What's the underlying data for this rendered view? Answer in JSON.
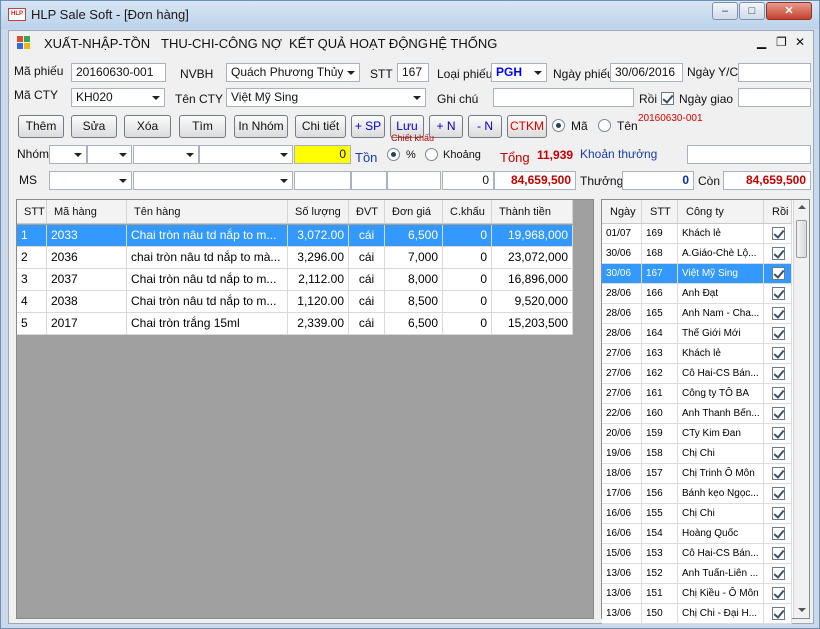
{
  "window": {
    "title": "HLP Sale Soft - [Đơn hàng]",
    "icon_text": "HLP"
  },
  "menu": {
    "items": [
      "XUẤT-NHẬP-TỒN",
      "THU-CHI-CÔNG NỢ",
      "KẾT QUẢ HOẠT ĐỘNG",
      "HỆ THỐNG"
    ]
  },
  "form": {
    "ma_phieu_label": "Mã phiếu",
    "ma_phieu": "20160630-001",
    "nvbh_label": "NVBH",
    "nvbh": "Quách Phương Thủy",
    "stt_label": "STT",
    "stt": "167",
    "loai_phieu_label": "Loại phiếu",
    "loai_phieu": "PGH",
    "ngay_phieu_label": "Ngày phiếu",
    "ngay_phieu": "30/06/2016",
    "ngay_yc_label": "Ngày Y/C",
    "ngay_yc": "",
    "ma_cty_label": "Mã CTY",
    "ma_cty": "KH020",
    "ten_cty_label": "Tên CTY",
    "ten_cty": "Việt Mỹ Sing",
    "ghi_chu_label": "Ghi chú",
    "ghi_chu": "",
    "roi_label": "Rồi",
    "ngay_giao_label": "Ngày giao",
    "ngay_giao": ""
  },
  "toolbar": {
    "them": "Thêm",
    "sua": "Sửa",
    "xoa": "Xóa",
    "tim": "Tìm",
    "in_nhom": "In Nhóm",
    "chi_tiet": "Chi tiết",
    "add_sp": "+ SP",
    "luu": "Lưu",
    "add_n": "+ N",
    "sub_n": "- N",
    "ctkm": "CTKM",
    "ma_radio": "Mã",
    "ten_radio": "Tên",
    "code_ref": "20160630-001"
  },
  "discount": {
    "nhom_label": "Nhóm",
    "ton_value": "0",
    "ton_label": "Tồn",
    "chiet_khau_label": "Chiết khấu",
    "percent_label": "%",
    "khoang_label": "Khoảng",
    "tong_label": "Tổng",
    "tong_value": "11,939",
    "khoan_thuong_label": "Khoản thưởng",
    "khoan_thuong": ""
  },
  "summary": {
    "ms_label": "MS",
    "qty_value": "0",
    "total_value": "84,659,500",
    "thuong_label": "Thưởng",
    "thuong_value": "0",
    "con_label": "Còn",
    "con_value": "84,659,500"
  },
  "items_table": {
    "headers": [
      "STT",
      "Mã hàng",
      "Tên hàng",
      "Số lượng",
      "ĐVT",
      "Đơn giá",
      "C.khấu",
      "Thành tiền"
    ],
    "rows": [
      {
        "stt": "1",
        "ma": "2033",
        "ten": "Chai tròn nâu td nắp to m...",
        "sl": "3,072.00",
        "dvt": "cái",
        "dg": "6,500",
        "ck": "0",
        "tt": "19,968,000",
        "selected": true
      },
      {
        "stt": "2",
        "ma": "2036",
        "ten": "chai tròn nâu td nắp to mà...",
        "sl": "3,296.00",
        "dvt": "cái",
        "dg": "7,000",
        "ck": "0",
        "tt": "23,072,000",
        "selected": false
      },
      {
        "stt": "3",
        "ma": "2037",
        "ten": "Chai tròn nâu td nắp to m...",
        "sl": "2,112.00",
        "dvt": "cái",
        "dg": "8,000",
        "ck": "0",
        "tt": "16,896,000",
        "selected": false
      },
      {
        "stt": "4",
        "ma": "2038",
        "ten": "Chai tròn nâu td nắp to m...",
        "sl": "1,120.00",
        "dvt": "cái",
        "dg": "8,500",
        "ck": "0",
        "tt": "9,520,000",
        "selected": false
      },
      {
        "stt": "5",
        "ma": "2017",
        "ten": "Chai tròn trắng 15ml",
        "sl": "2,339.00",
        "dvt": "cái",
        "dg": "6,500",
        "ck": "0",
        "tt": "15,203,500",
        "selected": false
      }
    ]
  },
  "orders_table": {
    "headers": [
      "Ngày",
      "STT",
      "Công ty",
      "Rồi"
    ],
    "rows": [
      {
        "ngay": "01/07",
        "stt": "169",
        "cty": "Khách lẻ"
      },
      {
        "ngay": "30/06",
        "stt": "168",
        "cty": "A.Giáo-Chè Lộ..."
      },
      {
        "ngay": "30/06",
        "stt": "167",
        "cty": "Việt Mỹ Sing",
        "selected": true
      },
      {
        "ngay": "28/06",
        "stt": "166",
        "cty": "Anh Đạt"
      },
      {
        "ngay": "28/06",
        "stt": "165",
        "cty": "Anh Nam - Cha..."
      },
      {
        "ngay": "28/06",
        "stt": "164",
        "cty": "Thế Giới Mới"
      },
      {
        "ngay": "27/06",
        "stt": "163",
        "cty": "Khách lẻ"
      },
      {
        "ngay": "27/06",
        "stt": "162",
        "cty": "Cô Hai-CS Bán..."
      },
      {
        "ngay": "27/06",
        "stt": "161",
        "cty": "Công ty TÔ BA"
      },
      {
        "ngay": "22/06",
        "stt": "160",
        "cty": "Anh Thanh Bến..."
      },
      {
        "ngay": "20/06",
        "stt": "159",
        "cty": "CTy Kim Đan"
      },
      {
        "ngay": "19/06",
        "stt": "158",
        "cty": "Chị Chi"
      },
      {
        "ngay": "18/06",
        "stt": "157",
        "cty": "Chị Trinh Ô Môn"
      },
      {
        "ngay": "17/06",
        "stt": "156",
        "cty": "Bánh kẹo Ngọc..."
      },
      {
        "ngay": "16/06",
        "stt": "155",
        "cty": "Chị Chi"
      },
      {
        "ngay": "16/06",
        "stt": "154",
        "cty": "Hoàng Quốc"
      },
      {
        "ngay": "15/06",
        "stt": "153",
        "cty": "Cô Hai-CS Bán..."
      },
      {
        "ngay": "13/06",
        "stt": "152",
        "cty": "Anh Tuấn-Liên ..."
      },
      {
        "ngay": "13/06",
        "stt": "151",
        "cty": "Chị Kiều - Ô Môn"
      },
      {
        "ngay": "13/06",
        "stt": "150",
        "cty": "Chị Chi - Đại H..."
      }
    ]
  }
}
